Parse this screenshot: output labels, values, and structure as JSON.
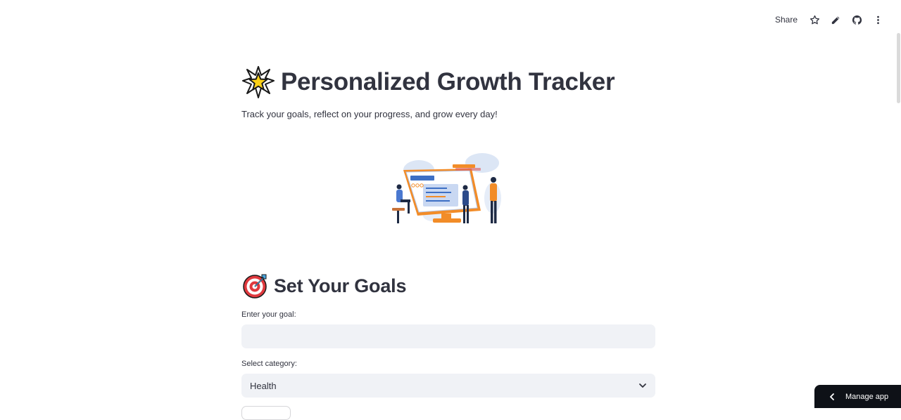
{
  "toolbar": {
    "share_label": "Share",
    "icons": [
      "star-icon",
      "pencil-icon",
      "github-icon",
      "more-vertical-icon"
    ]
  },
  "header": {
    "title": "Personalized Growth Tracker",
    "title_emoji": "glowing-star",
    "subtitle": "Track your goals, reflect on your progress, and grow every day!"
  },
  "hero_image": {
    "description_icon": "team-dashboard-illustration"
  },
  "goals_section": {
    "heading": "Set Your Goals",
    "heading_emoji": "direct-hit-target",
    "goal_label": "Enter your goal:",
    "goal_value": "",
    "goal_placeholder": "",
    "category_label": "Select category:",
    "category_value": "Health"
  },
  "manage_app": {
    "label": "Manage app"
  },
  "colors": {
    "text": "#31333f",
    "input_bg": "#f0f2f6",
    "manage_bg": "#0e1117",
    "accent_orange": "#f28c28",
    "accent_blue": "#3d6fc4"
  }
}
